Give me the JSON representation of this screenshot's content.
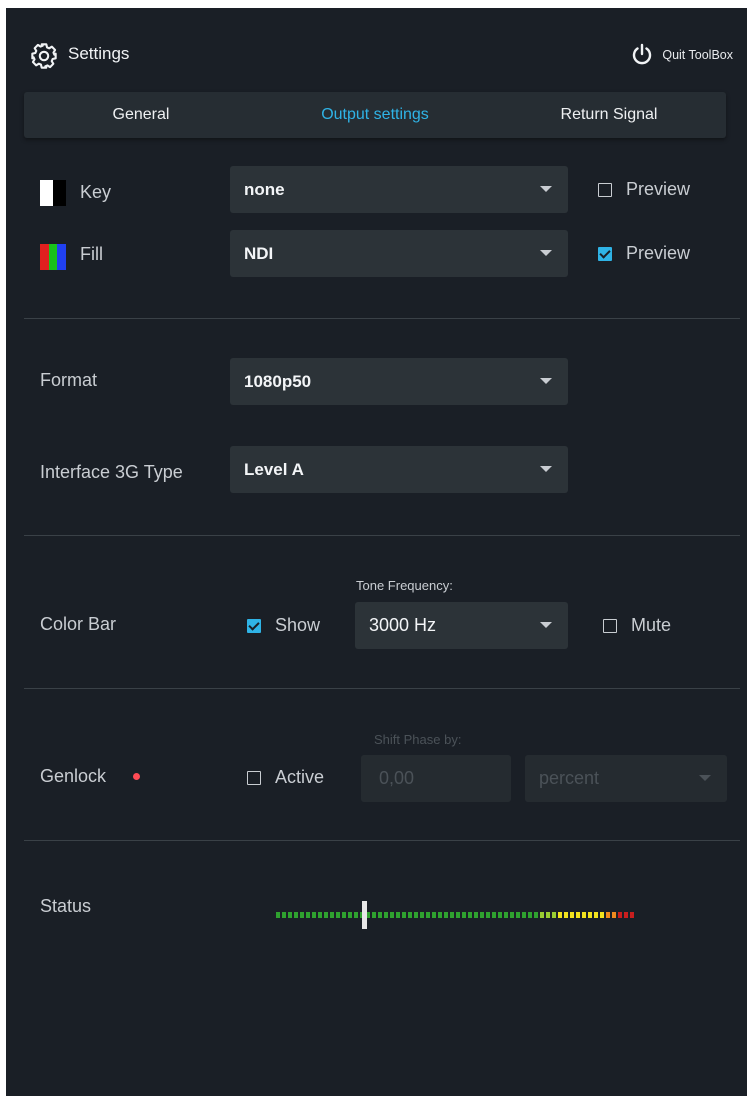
{
  "header": {
    "title": "Settings",
    "quit_label": "Quit ToolBox"
  },
  "tabs": [
    {
      "label": "General",
      "active": false
    },
    {
      "label": "Output settings",
      "active": true
    },
    {
      "label": "Return Signal",
      "active": false
    }
  ],
  "key_row": {
    "label": "Key",
    "select": "none",
    "preview_label": "Preview",
    "preview_checked": false
  },
  "fill_row": {
    "label": "Fill",
    "select": "NDI",
    "preview_label": "Preview",
    "preview_checked": true
  },
  "format": {
    "label": "Format",
    "value": "1080p50"
  },
  "interface": {
    "label": "Interface 3G Type",
    "value": "Level A"
  },
  "color_bar": {
    "label": "Color Bar",
    "show_label": "Show",
    "show_checked": true,
    "tone_label": "Tone Frequency:",
    "tone_value": "3000 Hz",
    "mute_label": "Mute",
    "mute_checked": false
  },
  "genlock": {
    "label": "Genlock",
    "active_label": "Active",
    "active_checked": false,
    "shift_label": "Shift Phase by:",
    "shift_value": "0,00",
    "unit": "percent",
    "status_color": "#ff4b55"
  },
  "status": {
    "label": "Status",
    "meter_level": 0.24
  },
  "colors": {
    "accent": "#2fb3e6",
    "background": "#1a1f26",
    "control": "#2c3338"
  }
}
